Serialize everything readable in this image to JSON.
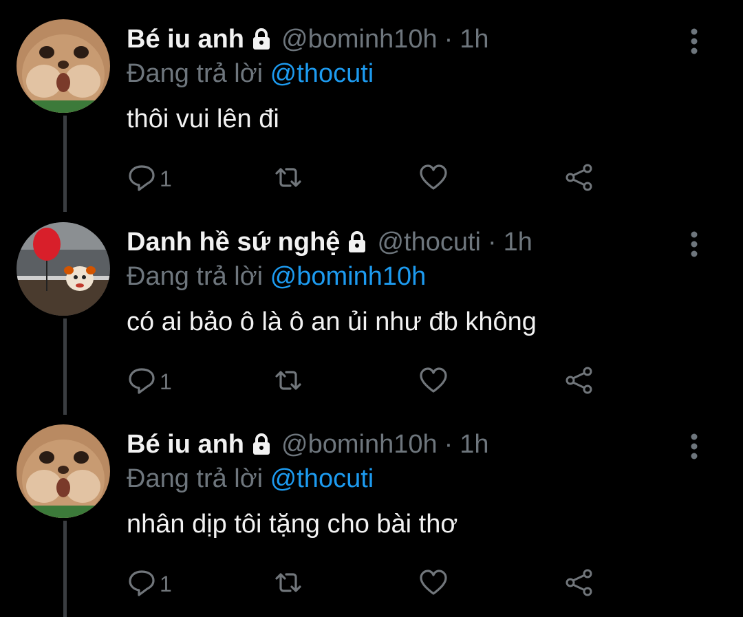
{
  "tweets": [
    {
      "display_name": "Bé iu anh",
      "handle": "@bominh10h",
      "separator": "·",
      "time": "1h",
      "replying_prefix": "Đang trả lời",
      "replying_to": "@thocuti",
      "text": "thôi vui lên đi",
      "reply_count": "1",
      "avatar": "chipmunk-avatar"
    },
    {
      "display_name": "Danh hề sứ nghệ",
      "handle": "@thocuti",
      "separator": "·",
      "time": "1h",
      "replying_prefix": "Đang trả lời",
      "replying_to": "@bominh10h",
      "text": "có ai bảo ô là ô an ủi như đb không",
      "reply_count": "1",
      "avatar": "clown-balloon-avatar"
    },
    {
      "display_name": "Bé iu anh",
      "handle": "@bominh10h",
      "separator": "·",
      "time": "1h",
      "replying_prefix": "Đang trả lời",
      "replying_to": "@thocuti",
      "text": "nhân dịp tôi tặng cho bài thơ",
      "reply_count": "1",
      "avatar": "chipmunk-avatar"
    }
  ],
  "icons": {
    "lock": "lock-icon",
    "more": "more-vertical-icon",
    "reply": "reply-icon",
    "retweet": "retweet-icon",
    "like": "heart-icon",
    "share": "share-icon"
  },
  "colors": {
    "background": "#000000",
    "text": "#f2f2f2",
    "muted": "#6e767d",
    "link": "#1d9bf0",
    "thread_line": "#3a3d41"
  }
}
